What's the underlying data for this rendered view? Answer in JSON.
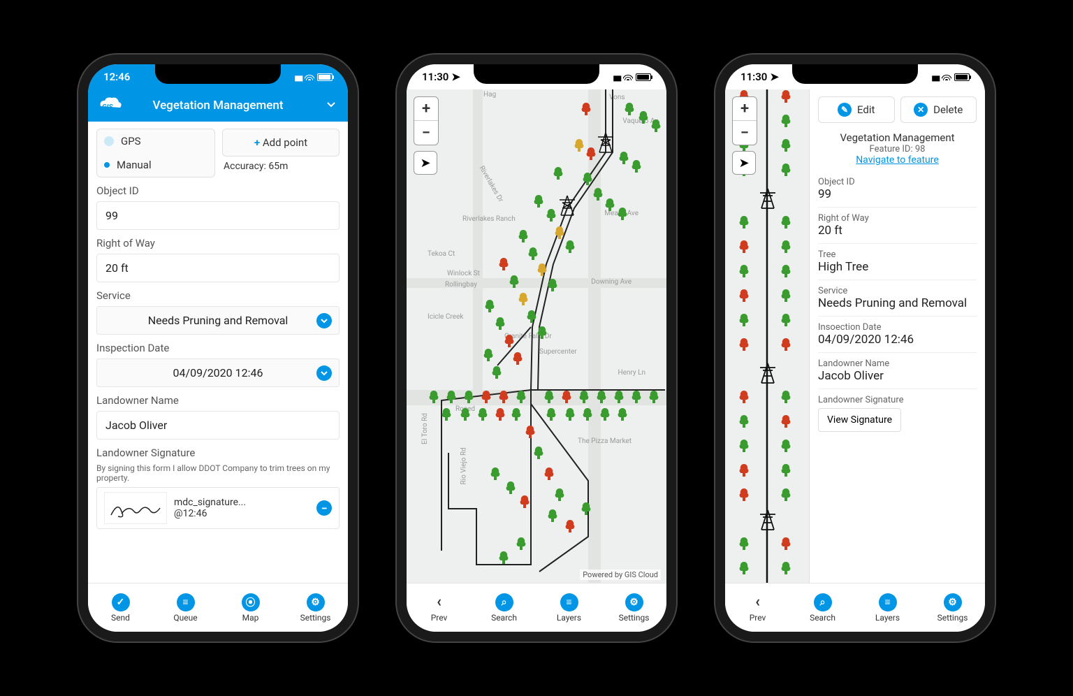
{
  "phone1": {
    "status_time": "12:46",
    "header_title": "Vegetation Management",
    "mode": {
      "gps": "GPS",
      "manual": "Manual"
    },
    "add_point": "Add point",
    "accuracy": "Accuracy: 65m",
    "fields": {
      "object_id": {
        "label": "Object ID",
        "value": "99"
      },
      "right_of_way": {
        "label": "Right of Way",
        "value": "20 ft"
      },
      "service": {
        "label": "Service",
        "value": "Needs Pruning and Removal"
      },
      "inspection_date": {
        "label": "Inspection Date",
        "value": "04/09/2020 12:46"
      },
      "landowner_name": {
        "label": "Landowner Name",
        "value": "Jacob Oliver"
      },
      "landowner_signature": {
        "label": "Landowner Signature",
        "disclaimer": "By signing this form I allow DDOT Company to trim trees on my property.",
        "file": "mdc_signature...",
        "time": "@12:46"
      }
    },
    "nav": {
      "send": "Send",
      "queue": "Queue",
      "map": "Map",
      "settings": "Settings"
    }
  },
  "phone2": {
    "status_time": "11:30",
    "attribution": "Powered by GIS Cloud",
    "streets": [
      "Hag",
      "Vons",
      "Vaquero Av",
      "Riverlakes Dr",
      "Riverlakes Ranch",
      "Meany Ave",
      "Tekoa Ct",
      "Winlock St",
      "Rollingbay",
      "Downing Ave",
      "Icicle Creek",
      "Granite Falls Dr",
      "Supercenter",
      "Henry Ln",
      "El Toro Rd",
      "The Pizza Market",
      "Rosed",
      "Rio Viejo Rd"
    ],
    "nav": {
      "prev": "Prev",
      "search": "Search",
      "layers": "Layers",
      "settings": "Settings"
    }
  },
  "phone3": {
    "status_time": "11:30",
    "edit": "Edit",
    "delete": "Delete",
    "title": "Vegetation Management",
    "feature_id": "Feature ID: 98",
    "navigate": "Navigate to feature",
    "rows": {
      "object_id": {
        "label": "Object ID",
        "value": "99"
      },
      "right_of_way": {
        "label": "Right of Way",
        "value": "20 ft"
      },
      "tree": {
        "label": "Tree",
        "value": "High Tree"
      },
      "service": {
        "label": "Service",
        "value": "Needs Pruning and Removal"
      },
      "inspection_date": {
        "label": "Insoection Date",
        "value": "04/09/2020  12:46"
      },
      "landowner_name": {
        "label": "Landowner Name",
        "value": "Jacob Oliver"
      },
      "landowner_signature": {
        "label": "Landowner Signature"
      }
    },
    "view_signature": "View Signature",
    "nav": {
      "prev": "Prev",
      "search": "Search",
      "layers": "Layers",
      "settings": "Settings"
    }
  }
}
